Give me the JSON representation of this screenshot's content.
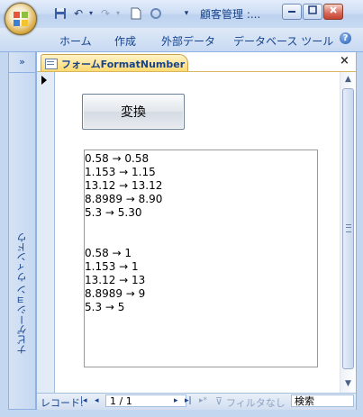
{
  "window": {
    "title": "顧客管理 :...",
    "controls": {
      "minimize": "▭",
      "maximize": "▢",
      "close": "✕"
    }
  },
  "quick_access": {
    "icons": [
      "save-icon",
      "undo-icon",
      "redo-icon",
      "new-document-icon",
      "refresh-icon",
      "customize-qat-icon"
    ],
    "undo_label": "↶",
    "redo_label": "↷",
    "customize_label": "▾"
  },
  "ribbon": {
    "tabs": [
      "ホーム",
      "作成",
      "外部データ",
      "データベース ツール"
    ],
    "help": "?"
  },
  "navigation_pane": {
    "toggle": "»",
    "label": "ナビゲーション ウィンドウ"
  },
  "document": {
    "tab_label": "フォームFormatNumber",
    "close": "×",
    "convert_button": "変換",
    "output_lines": [
      "0.58 → 0.58",
      "1.153 → 1.15",
      "13.12 → 13.12",
      "8.8989 → 8.90",
      "5.3 → 5.30",
      "",
      "",
      "0.58 → 1",
      "1.153 → 1",
      "13.12 → 13",
      "8.8989 → 9",
      "5.3 → 5"
    ]
  },
  "record_nav": {
    "label": "レコード:",
    "first": "|◂",
    "prev": "◂",
    "counter": "1 / 1",
    "next": "▸",
    "last": "▸|",
    "new": "▸*",
    "filter": "フィルタなし",
    "search_placeholder": "検索"
  },
  "colors": {
    "accent_tab": "#ffd96e",
    "frame": "#c4d7f0",
    "text": "#15428b"
  }
}
